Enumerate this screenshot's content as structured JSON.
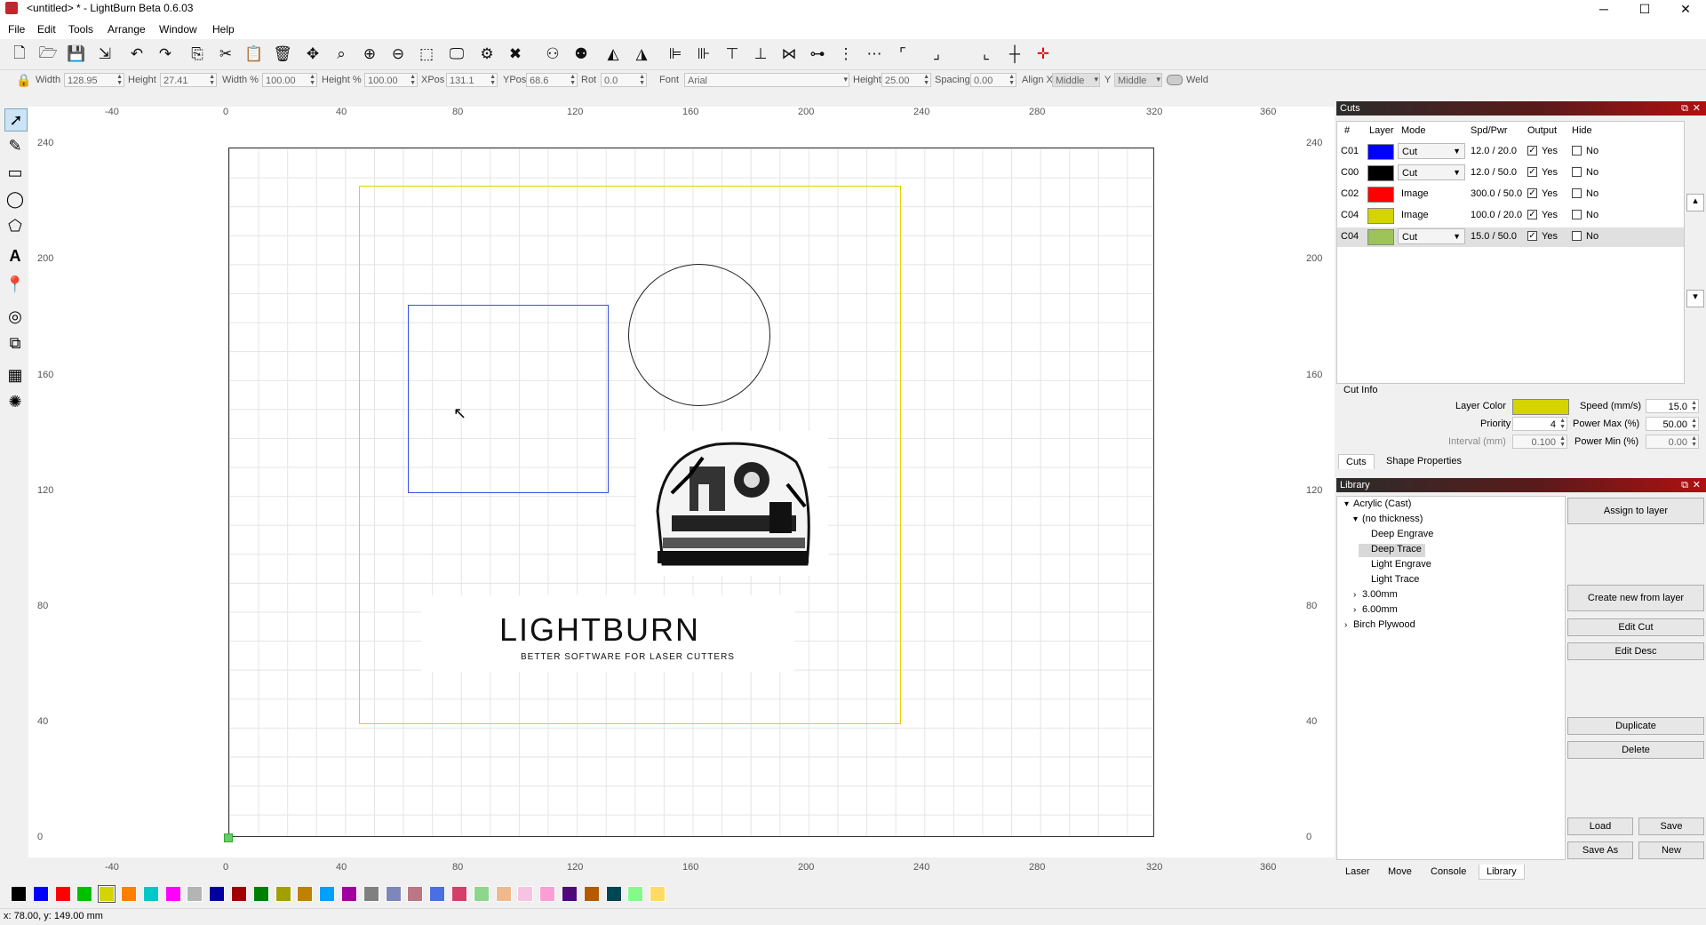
{
  "window": {
    "title": "<untitled> * - LightBurn Beta 0.6.03",
    "minimize": "─",
    "maximize": "☐",
    "close": "✕"
  },
  "menu": [
    "File",
    "Edit",
    "Tools",
    "Arrange",
    "Window",
    "Help"
  ],
  "toolbar_icons": [
    "new-file-icon",
    "open-file-icon",
    "save-icon",
    "import-icon",
    "undo-icon",
    "redo-icon",
    "copy-icon",
    "cut-icon",
    "paste-icon",
    "delete-icon",
    "move-icon",
    "zoom-fit-icon",
    "zoom-in-icon",
    "zoom-out-icon",
    "select-all-icon",
    "frame-icon",
    "settings-icon",
    "tools-icon",
    "group-icon",
    "ungroup-icon",
    "mirror-h-icon",
    "mirror-v-icon",
    "align-left-icon",
    "align-right-icon",
    "align-top-icon",
    "align-bottom-icon",
    "align-hcenter-icon",
    "align-vcenter-icon",
    "distribute-icon",
    "corner-icon",
    "move-corner-icon",
    "move-bottom-icon",
    "move-center-icon",
    "laser-origin-icon"
  ],
  "props": {
    "width_label": "Width",
    "width": "128.95",
    "height_label": "Height",
    "height": "27.41",
    "widthpct_label": "Width %",
    "widthpct": "100.00",
    "heightpct_label": "Height %",
    "heightpct": "100.00",
    "xpos_label": "XPos",
    "xpos": "131.1",
    "ypos_label": "YPos",
    "ypos": "68.6",
    "rot_label": "Rot",
    "rot": "0.0",
    "font_label": "Font",
    "font": "Arial",
    "fheight_label": "Height",
    "fheight": "25.00",
    "spacing_label": "Spacing",
    "spacing": "0.00",
    "alignx_label": "Align X",
    "alignx": "Middle",
    "aligny_label": "Y",
    "aligny": "Middle",
    "weld_label": "Weld"
  },
  "ruler": {
    "x": [
      "-40",
      "0",
      "40",
      "80",
      "120",
      "160",
      "200",
      "240",
      "280",
      "320",
      "360"
    ],
    "y": [
      "240",
      "200",
      "160",
      "120",
      "80",
      "40",
      "0"
    ]
  },
  "canvas": {
    "logo_text": "LIGHTBURN",
    "logo_sub": "BETTER SOFTWARE FOR LASER CUTTERS"
  },
  "cuts": {
    "title": "Cuts",
    "headers": [
      "#",
      "Layer",
      "Mode",
      "Spd/Pwr",
      "Output",
      "Hide"
    ],
    "rows": [
      {
        "num": "C01",
        "color": "#0000ff",
        "mode": "Cut",
        "spd": "12.0 / 20.0",
        "output": "Yes",
        "hide": "No",
        "dropdown": true
      },
      {
        "num": "C00",
        "color": "#000000",
        "mode": "Cut",
        "spd": "12.0 / 50.0",
        "output": "Yes",
        "hide": "No",
        "dropdown": true
      },
      {
        "num": "C02",
        "color": "#ff0000",
        "mode": "Image",
        "spd": "300.0 / 50.0",
        "output": "Yes",
        "hide": "No",
        "dropdown": false
      },
      {
        "num": "C04",
        "color": "#d4d400",
        "mode": "Image",
        "spd": "100.0 / 20.0",
        "output": "Yes",
        "hide": "No",
        "dropdown": false
      },
      {
        "num": "C04",
        "color": "#9cc45a",
        "mode": "Cut",
        "spd": "15.0 / 50.0",
        "output": "Yes",
        "hide": "No",
        "dropdown": true
      }
    ]
  },
  "cutinfo": {
    "title": "Cut Info",
    "layer_color_label": "Layer Color",
    "layer_color": "#d4d400",
    "speed_label": "Speed (mm/s)",
    "speed": "15.0",
    "priority_label": "Priority",
    "priority": "4",
    "powermax_label": "Power Max (%)",
    "powermax": "50.00",
    "interval_label": "Interval (mm)",
    "interval": "0.100",
    "powermin_label": "Power Min (%)",
    "powermin": "0.00"
  },
  "cut_tabs": [
    "Cuts",
    "Shape Properties"
  ],
  "library": {
    "title": "Library",
    "tree": [
      {
        "label": "Acrylic (Cast)",
        "indent": 0,
        "arrow": "▾"
      },
      {
        "label": "(no thickness)",
        "indent": 1,
        "arrow": "▾"
      },
      {
        "label": "Deep Engrave",
        "indent": 2,
        "arrow": ""
      },
      {
        "label": "Deep Trace",
        "indent": 2,
        "arrow": "",
        "selected": true
      },
      {
        "label": "Light Engrave",
        "indent": 2,
        "arrow": ""
      },
      {
        "label": "Light Trace",
        "indent": 2,
        "arrow": ""
      },
      {
        "label": "3.00mm",
        "indent": 1,
        "arrow": "›"
      },
      {
        "label": "6.00mm",
        "indent": 1,
        "arrow": "›"
      },
      {
        "label": "Birch Plywood",
        "indent": 0,
        "arrow": "›"
      }
    ],
    "assign": "Assign to layer",
    "create": "Create new from layer",
    "edit_cut": "Edit Cut",
    "edit_desc": "Edit Desc",
    "duplicate": "Duplicate",
    "delete": "Delete",
    "load": "Load",
    "save": "Save",
    "save_as": "Save As",
    "new": "New"
  },
  "bottom_tabs": [
    "Laser",
    "Move",
    "Console",
    "Library"
  ],
  "palette": [
    "#000000",
    "#0000ff",
    "#ff0000",
    "#00c000",
    "#d4d400",
    "#ff8000",
    "#00c8c8",
    "#ff00ff",
    "#b4b4b4",
    "#0000a0",
    "#a00000",
    "#008000",
    "#a0a000",
    "#c08000",
    "#00a0ff",
    "#a000a0",
    "#808080",
    "#7d87b9",
    "#bb7784",
    "#4a6fe3",
    "#d33f6a",
    "#8cd78c",
    "#f0b98d",
    "#f6c4e1",
    "#fa9ed4",
    "#500a78",
    "#b45a00",
    "#004754",
    "#86fa88",
    "#ffdb66"
  ],
  "status": "x: 78.00, y: 149.00 mm"
}
